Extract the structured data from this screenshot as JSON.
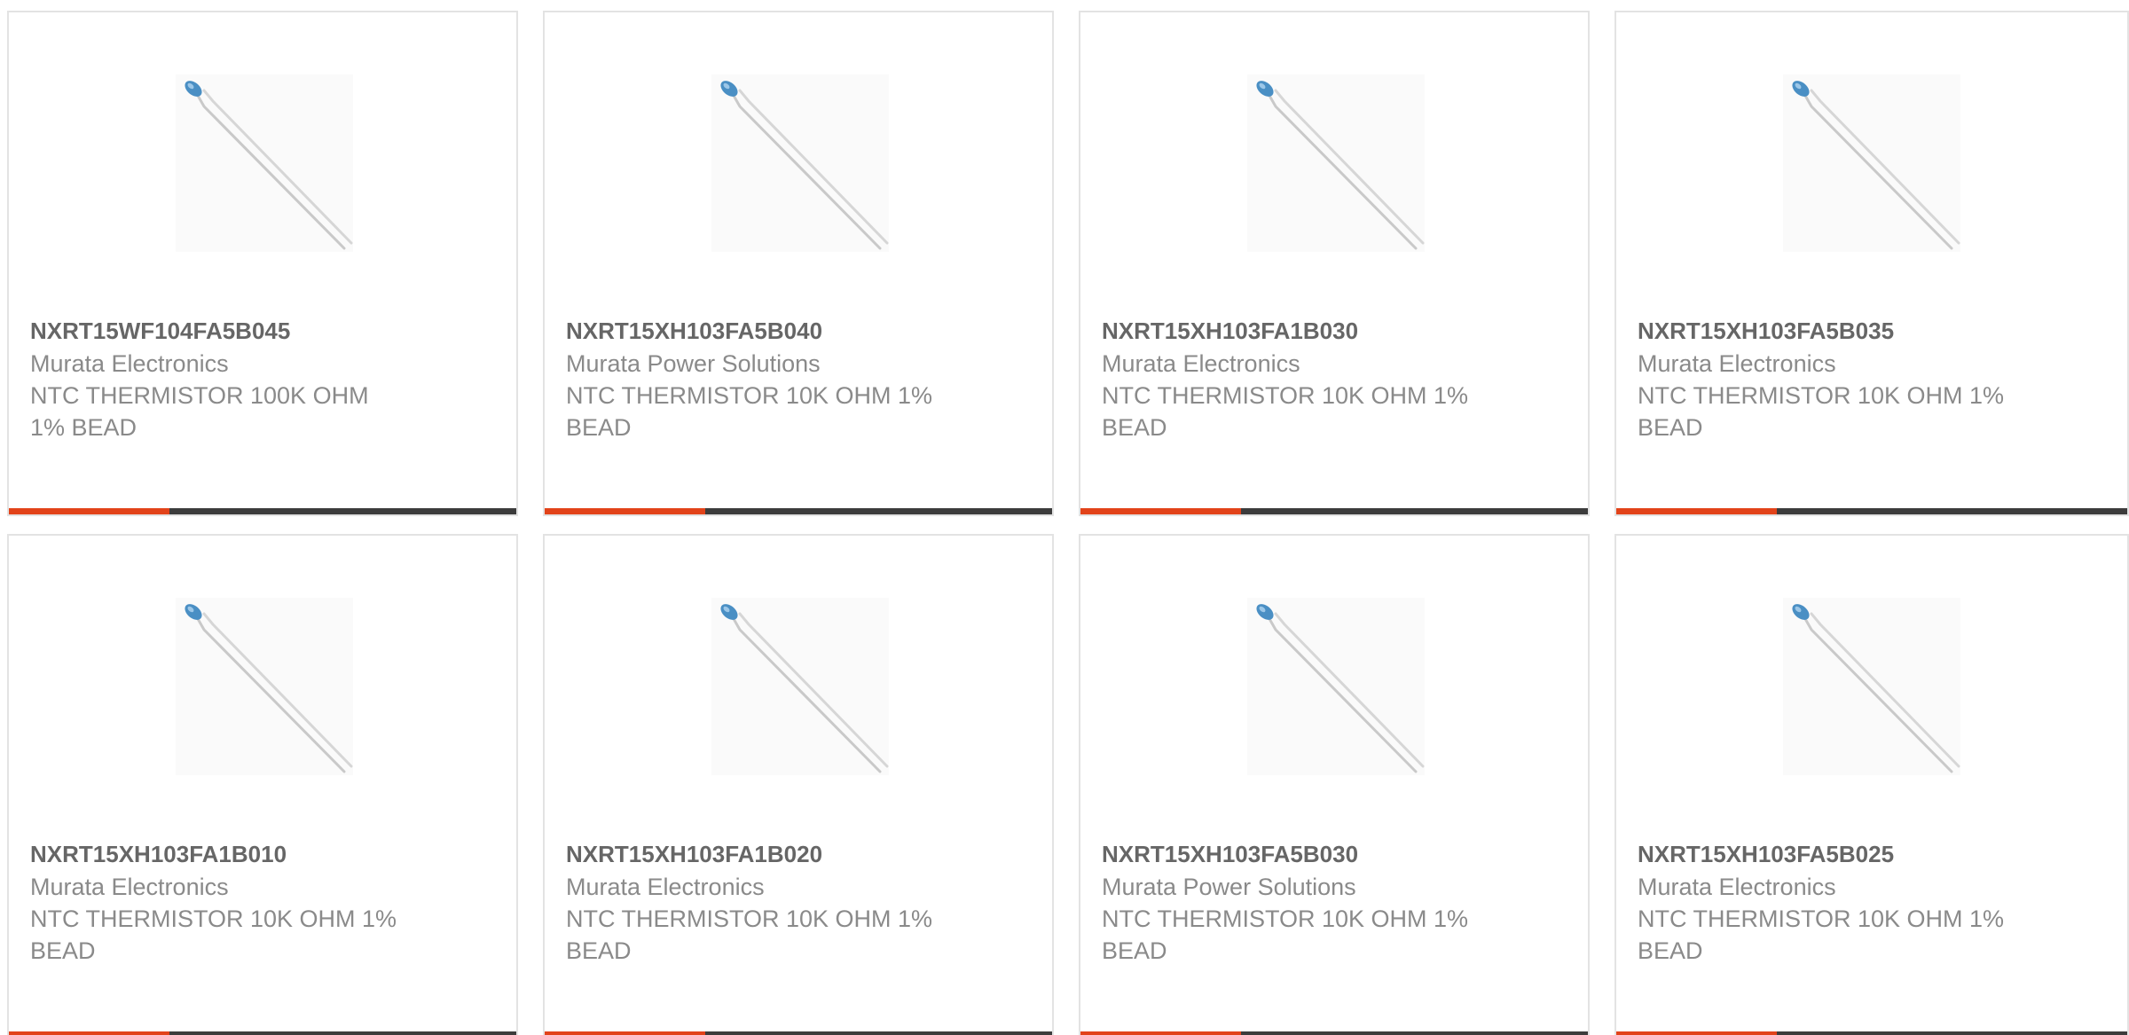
{
  "colors": {
    "accent": "#e2431a",
    "bar": "#3c3c3c",
    "part_text": "#666666",
    "secondary_text": "#8a8a8a",
    "card_border": "#e3e3e3",
    "bead": "#4a8fc4"
  },
  "products": [
    {
      "part": "NXRT15WF104FA5B045",
      "manufacturer": "Murata Electronics",
      "description": "NTC THERMISTOR 100K OHM 1% BEAD",
      "image_icon": "thermistor-image"
    },
    {
      "part": "NXRT15XH103FA5B040",
      "manufacturer": "Murata Power Solutions",
      "description": "NTC THERMISTOR 10K OHM 1% BEAD",
      "image_icon": "thermistor-image"
    },
    {
      "part": "NXRT15XH103FA1B030",
      "manufacturer": "Murata Electronics",
      "description": "NTC THERMISTOR 10K OHM 1% BEAD",
      "image_icon": "thermistor-image"
    },
    {
      "part": "NXRT15XH103FA5B035",
      "manufacturer": "Murata Electronics",
      "description": "NTC THERMISTOR 10K OHM 1% BEAD",
      "image_icon": "thermistor-image"
    },
    {
      "part": "NXRT15XH103FA1B010",
      "manufacturer": "Murata Electronics",
      "description": "NTC THERMISTOR 10K OHM 1% BEAD",
      "image_icon": "thermistor-image"
    },
    {
      "part": "NXRT15XH103FA1B020",
      "manufacturer": "Murata Electronics",
      "description": "NTC THERMISTOR 10K OHM 1% BEAD",
      "image_icon": "thermistor-image"
    },
    {
      "part": "NXRT15XH103FA5B030",
      "manufacturer": "Murata Power Solutions",
      "description": "NTC THERMISTOR 10K OHM 1% BEAD",
      "image_icon": "thermistor-image"
    },
    {
      "part": "NXRT15XH103FA5B025",
      "manufacturer": "Murata Electronics",
      "description": "NTC THERMISTOR 10K OHM 1% BEAD",
      "image_icon": "thermistor-image"
    }
  ]
}
